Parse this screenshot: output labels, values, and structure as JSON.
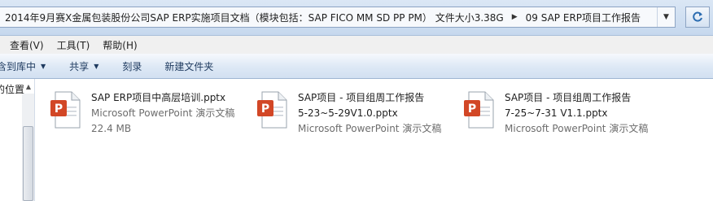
{
  "breadcrumb": {
    "items": [
      "2014年9月赛X金属包装股份公司SAP ERP实施项目文档（模块包括：SAP FICO MM SD PP PM） 文件大小3.38G",
      "09 SAP ERP项目工作报告"
    ],
    "separator_icon": "chevron-right-icon",
    "dropdown_icon": "chevron-down-icon"
  },
  "menu": {
    "items": [
      "查看(V)",
      "工具(T)",
      "帮助(H)"
    ]
  },
  "toolbar": {
    "include_in_library": "含到库中",
    "share": "共享",
    "burn": "刻录",
    "new_folder": "新建文件夹"
  },
  "navpane": {
    "label": "的位置"
  },
  "files": [
    {
      "name_line1": "SAP ERP项目中高层培训.pptx",
      "name_line2": "",
      "type": "Microsoft PowerPoint 演示文稿",
      "size": "22.4 MB"
    },
    {
      "name_line1": "SAP项目 - 项目组周工作报告",
      "name_line2": "5-23~5-29V1.0.pptx",
      "type": "Microsoft PowerPoint 演示文稿",
      "size": ""
    },
    {
      "name_line1": "SAP项目 - 项目组周工作报告",
      "name_line2": "7-25~7-31 V1.1.pptx",
      "type": "Microsoft PowerPoint 演示文稿",
      "size": ""
    }
  ],
  "colors": {
    "toolbar_text": "#1e3a5f",
    "pptx_accent": "#d24726",
    "secondary_text": "#6d6d6d"
  }
}
